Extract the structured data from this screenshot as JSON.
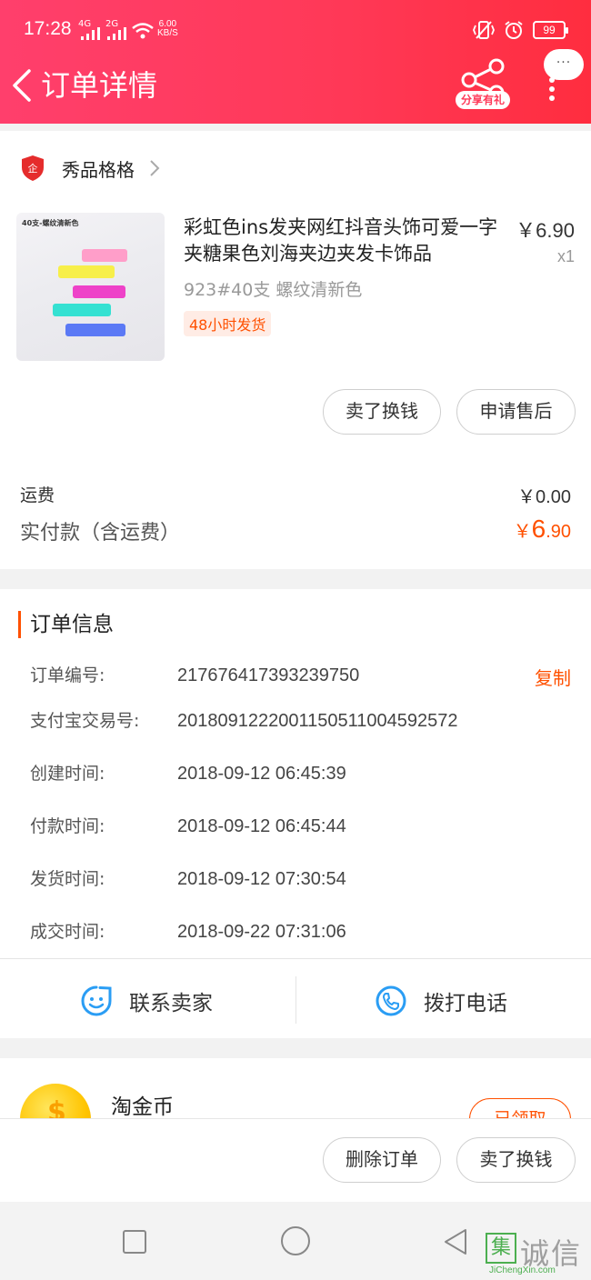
{
  "status_bar": {
    "time": "17:28",
    "sig1": "4G",
    "sig2": "2G",
    "speed_value": "6.00",
    "speed_unit": "KB/S",
    "battery": "99"
  },
  "header": {
    "title": "订单详情",
    "share_label": "分享有礼",
    "bubble": "···"
  },
  "shop": {
    "name": "秀品格格",
    "badge": "企"
  },
  "product": {
    "title": "彩虹色ins发夹网红抖音头饰可爱一字夹糖果色刘海夹边夹发卡饰品",
    "price": "￥6.90",
    "qty": "x1",
    "sku": "923#40支 螺纹清新色",
    "tag": "48小时发货",
    "thumb_label": "40支-螺纹清新色",
    "buttons": [
      "卖了换钱",
      "申请售后"
    ]
  },
  "fees": {
    "shipping_label": "运费",
    "shipping_value": "￥0.00",
    "paid_label": "实付款（含运费）",
    "paid_currency": "￥",
    "paid_int": "6",
    "paid_dec": ".90"
  },
  "order_info": {
    "title": "订单信息",
    "copy_label": "复制",
    "rows": [
      {
        "k": "订单编号:",
        "v": "217676417393239750"
      },
      {
        "k": "支付宝交易号:",
        "v": "2018091222001150511004592572"
      },
      {
        "k": "创建时间:",
        "v": "2018-09-12 06:45:39"
      },
      {
        "k": "付款时间:",
        "v": "2018-09-12 06:45:44"
      },
      {
        "k": "发货时间:",
        "v": "2018-09-12 07:30:54"
      },
      {
        "k": "成交时间:",
        "v": "2018-09-22 07:31:06"
      }
    ],
    "contact_seller": "联系卖家",
    "call_phone": "拨打电话"
  },
  "coin": {
    "title": "淘金币",
    "button": "已领取"
  },
  "actions": [
    "删除订单",
    "卖了换钱"
  ],
  "watermark": {
    "char": "集",
    "text": "诚信",
    "url": "JiChengXin.com"
  },
  "colors": {
    "header_start": "#ff3f6c",
    "header_end": "#ff2d3f",
    "accent": "#ff5000",
    "icon_blue": "#2a9df4"
  }
}
